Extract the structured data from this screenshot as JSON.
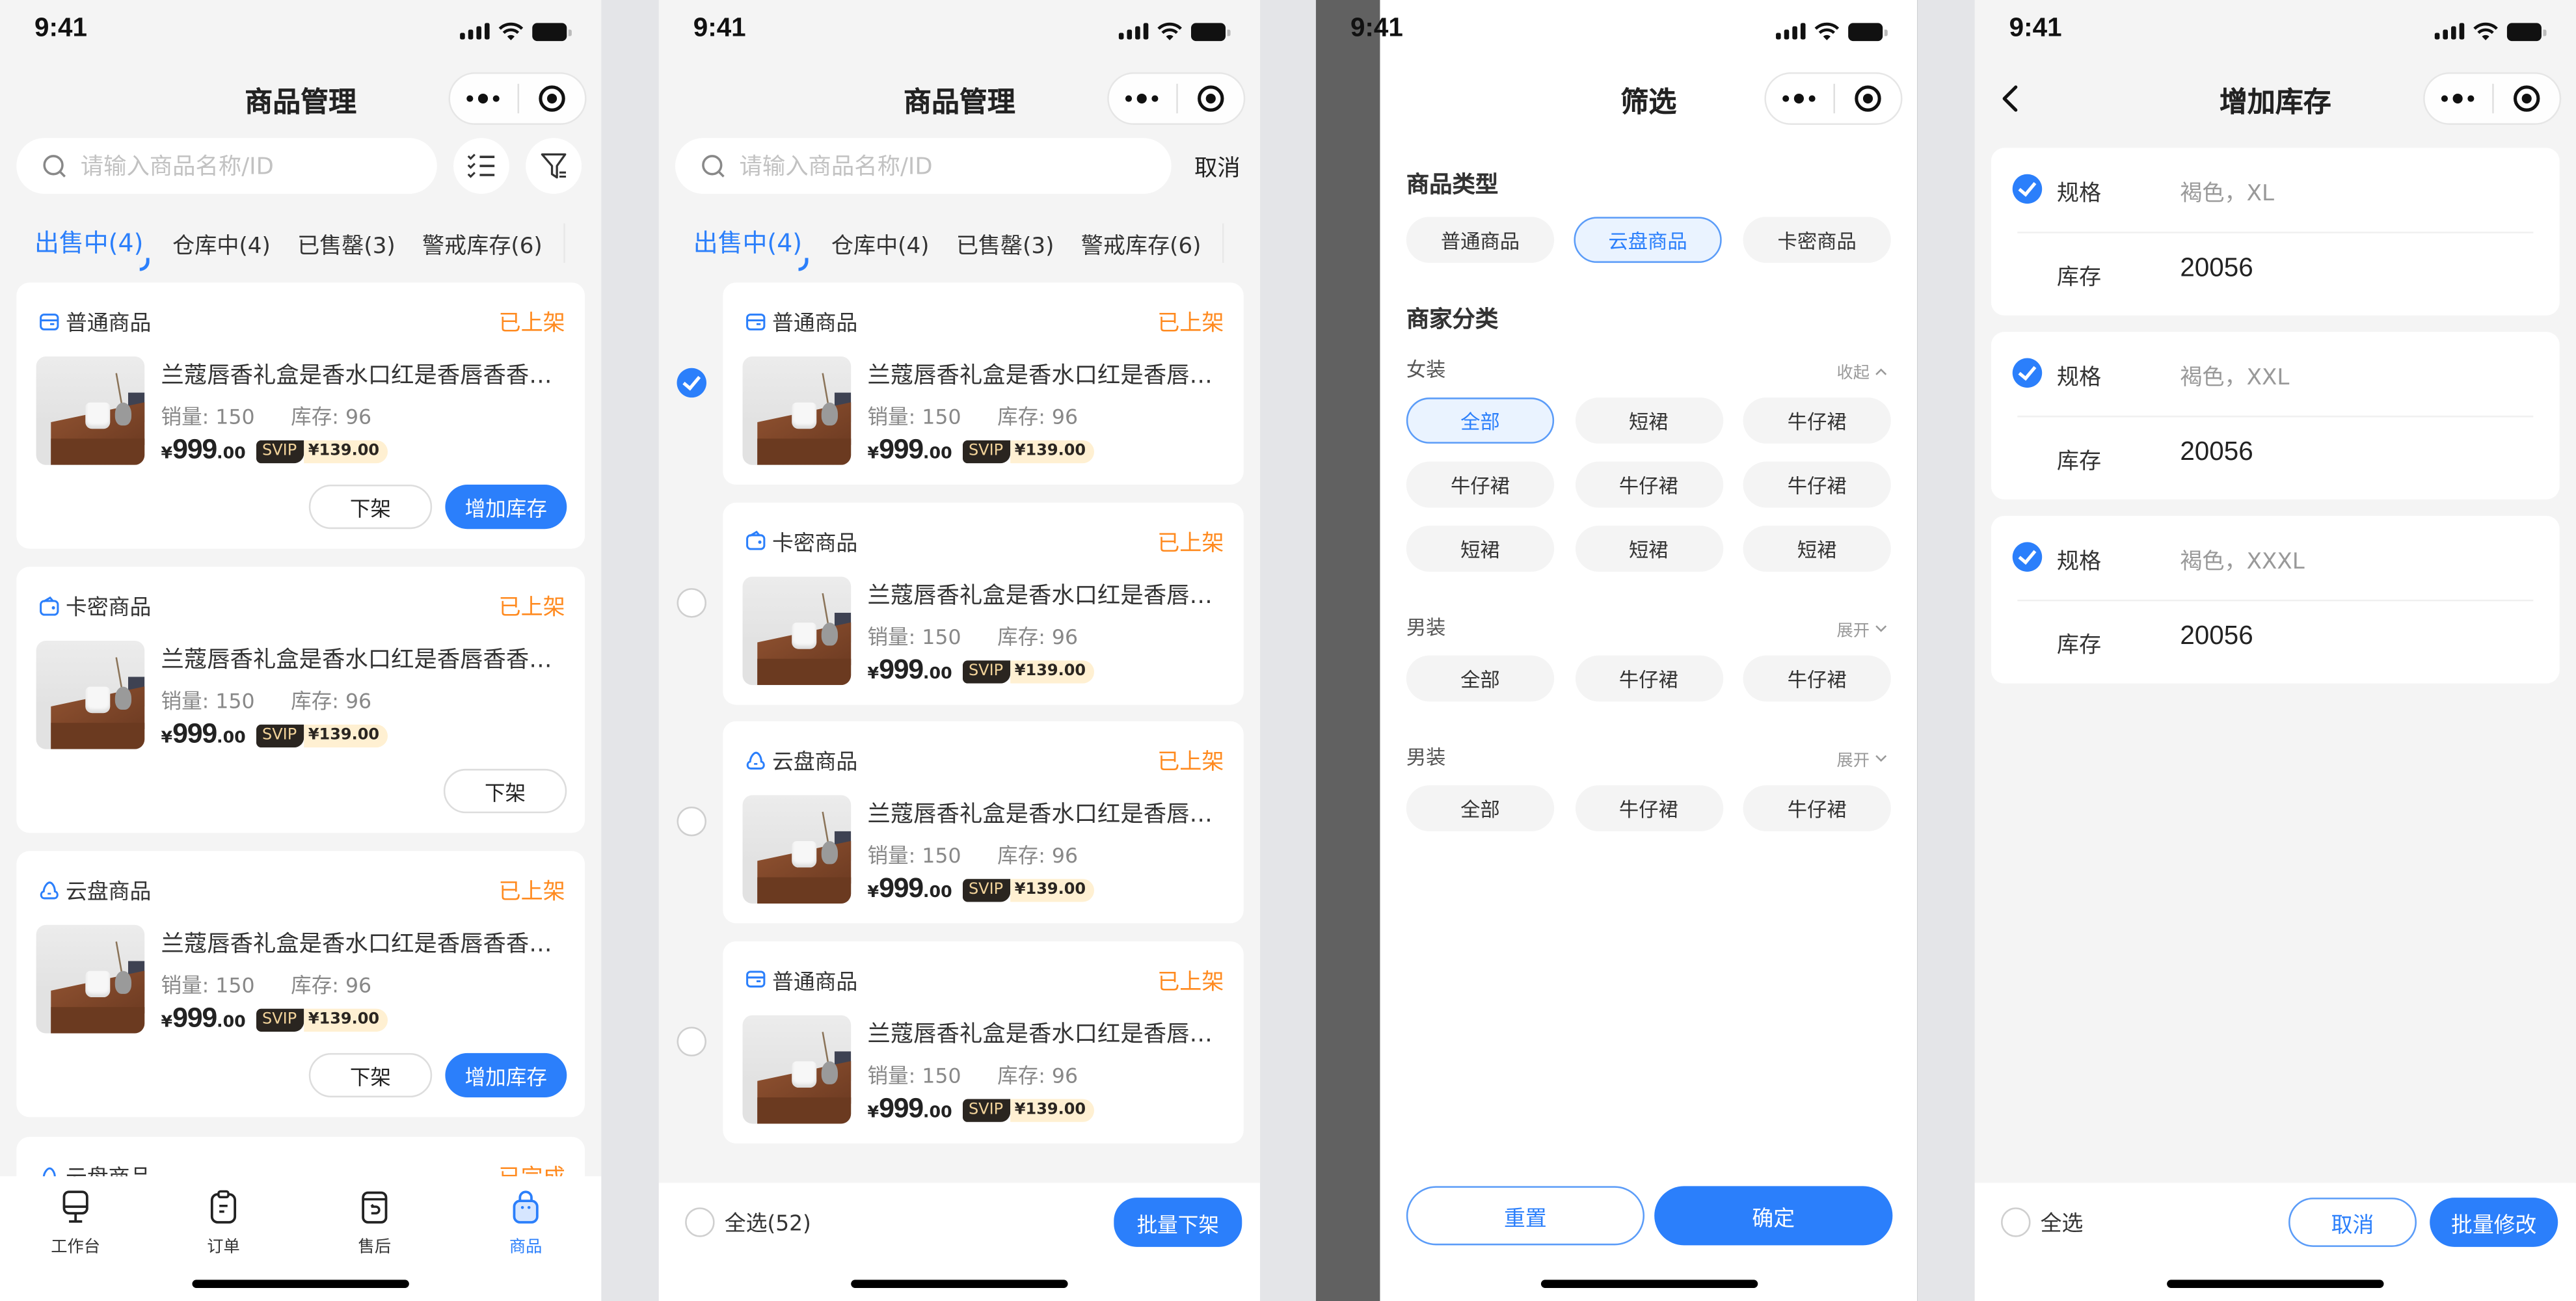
{
  "status_bar": {
    "time": "9:41"
  },
  "colors": {
    "accent": "#2b7ffb",
    "status_orange": "#ff8a1f",
    "overlay": "#616161",
    "page_bg": "#f4f4f4"
  },
  "product_list": {
    "title": "商品管理",
    "search_placeholder": "请输入商品名称/ID",
    "tabs": [
      {
        "label": "出售中(4)",
        "active": true
      },
      {
        "label": "仓库中(4)",
        "active": false
      },
      {
        "label": "已售罄(3)",
        "active": false
      },
      {
        "label": "警戒库存(6)",
        "active": false
      }
    ],
    "cards": [
      {
        "type": "普通商品",
        "type_icon": "wallet-icon",
        "status": "已上架",
        "name": "兰蔻唇香礼盒是香水口红是香唇香香礼盒",
        "sales": "销量: 150",
        "stock": "库存: 96",
        "price_currency": "¥",
        "price_int": "999",
        "price_dec": ".00",
        "svip_label": "SVIP",
        "svip_price": "¥139.00",
        "actions": [
          "下架",
          "增加库存"
        ]
      },
      {
        "type": "卡密商品",
        "type_icon": "card-wallet-icon",
        "status": "已上架",
        "name": "兰蔻唇香礼盒是香水口红是香唇香香礼盒",
        "sales": "销量: 150",
        "stock": "库存: 96",
        "price_currency": "¥",
        "price_int": "999",
        "price_dec": ".00",
        "svip_label": "SVIP",
        "svip_price": "¥139.00",
        "actions": [
          "下架"
        ]
      },
      {
        "type": "云盘商品",
        "type_icon": "cloud-icon",
        "status": "已上架",
        "name": "兰蔻唇香礼盒是香水口红是香唇香香礼盒",
        "sales": "销量: 150",
        "stock": "库存: 96",
        "price_currency": "¥",
        "price_int": "999",
        "price_dec": ".00",
        "svip_label": "SVIP",
        "svip_price": "¥139.00",
        "actions": [
          "下架",
          "增加库存"
        ]
      },
      {
        "type": "云盘商品",
        "type_icon": "cloud-icon",
        "status": "已完成"
      }
    ],
    "tabbar": [
      {
        "label": "工作台",
        "icon": "workbench-icon",
        "active": false
      },
      {
        "label": "订单",
        "icon": "order-icon",
        "active": false
      },
      {
        "label": "售后",
        "icon": "after-sales-icon",
        "active": false
      },
      {
        "label": "商品",
        "icon": "product-bag-icon",
        "active": true
      }
    ]
  },
  "batch_select": {
    "title": "商品管理",
    "search_placeholder": "请输入商品名称/ID",
    "cancel_label": "取消",
    "tabs": [
      {
        "label": "出售中(4)",
        "active": true
      },
      {
        "label": "仓库中(4)",
        "active": false
      },
      {
        "label": "已售罄(3)",
        "active": false
      },
      {
        "label": "警戒库存(6)",
        "active": false
      }
    ],
    "cards": [
      {
        "selected": true,
        "type": "普通商品",
        "status": "已上架",
        "name": "兰蔻唇香礼盒是香水口红是香唇香香礼盒",
        "sales": "销量: 150",
        "stock": "库存: 96",
        "price_currency": "¥",
        "price_int": "999",
        "price_dec": ".00",
        "svip_label": "SVIP",
        "svip_price": "¥139.00"
      },
      {
        "selected": false,
        "type": "卡密商品",
        "status": "已上架",
        "name": "兰蔻唇香礼盒是香水口红是香唇香香礼盒",
        "sales": "销量: 150",
        "stock": "库存: 96",
        "price_currency": "¥",
        "price_int": "999",
        "price_dec": ".00",
        "svip_label": "SVIP",
        "svip_price": "¥139.00"
      },
      {
        "selected": false,
        "type": "云盘商品",
        "status": "已上架",
        "name": "兰蔻唇香礼盒是香水口红是香唇香香礼盒",
        "sales": "销量: 150",
        "stock": "库存: 96",
        "price_currency": "¥",
        "price_int": "999",
        "price_dec": ".00",
        "svip_label": "SVIP",
        "svip_price": "¥139.00"
      },
      {
        "selected": false,
        "type": "普通商品",
        "status": "已上架",
        "name": "兰蔻唇香礼盒是香水口红是香唇香香礼盒",
        "sales": "销量: 150",
        "stock": "库存: 96",
        "price_currency": "¥",
        "price_int": "999",
        "price_dec": ".00",
        "svip_label": "SVIP",
        "svip_price": "¥139.00"
      }
    ],
    "select_all_label": "全选(52)",
    "batch_action_label": "批量下架"
  },
  "filter": {
    "title": "筛选",
    "product_type_title": "商品类型",
    "product_types": [
      {
        "label": "普通商品",
        "selected": false
      },
      {
        "label": "云盘商品",
        "selected": true
      },
      {
        "label": "卡密商品",
        "selected": false
      }
    ],
    "merchant_category_title": "商家分类",
    "groups": [
      {
        "title": "女装",
        "toggle": "收起",
        "expanded": true,
        "chips": [
          {
            "label": "全部",
            "selected": true
          },
          {
            "label": "短裙",
            "selected": false
          },
          {
            "label": "牛仔裙",
            "selected": false
          },
          {
            "label": "牛仔裙",
            "selected": false
          },
          {
            "label": "牛仔裙",
            "selected": false
          },
          {
            "label": "牛仔裙",
            "selected": false
          },
          {
            "label": "短裙",
            "selected": false
          },
          {
            "label": "短裙",
            "selected": false
          },
          {
            "label": "短裙",
            "selected": false
          }
        ]
      },
      {
        "title": "男装",
        "toggle": "展开",
        "expanded": false,
        "chips": [
          {
            "label": "全部",
            "selected": false
          },
          {
            "label": "牛仔裙",
            "selected": false
          },
          {
            "label": "牛仔裙",
            "selected": false
          }
        ]
      },
      {
        "title": "男装",
        "toggle": "展开",
        "expanded": false,
        "chips": [
          {
            "label": "全部",
            "selected": false
          },
          {
            "label": "牛仔裙",
            "selected": false
          },
          {
            "label": "牛仔裙",
            "selected": false
          }
        ]
      }
    ],
    "reset_label": "重置",
    "confirm_label": "确定"
  },
  "add_stock": {
    "title": "增加库存",
    "spec_label": "规格",
    "stock_label": "库存",
    "items": [
      {
        "selected": true,
        "spec": "褐色，XL",
        "stock": "20056"
      },
      {
        "selected": true,
        "spec": "褐色，XXL",
        "stock": "20056"
      },
      {
        "selected": true,
        "spec": "褐色，XXXL",
        "stock": "20056"
      }
    ],
    "select_all_label": "全选",
    "cancel_label": "取消",
    "batch_edit_label": "批量修改"
  }
}
